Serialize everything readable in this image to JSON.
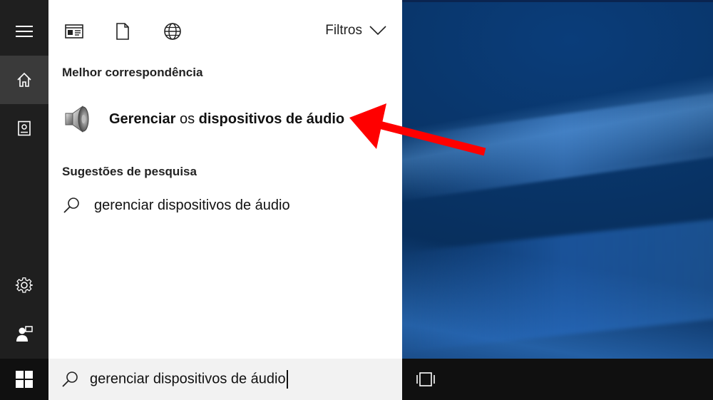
{
  "search_panel": {
    "filters_label": "Filtros",
    "best_match": {
      "section_title": "Melhor correspondência",
      "result": {
        "part1": "Gerenciar",
        "part2": " os ",
        "part3": "dispositivos de áudio"
      }
    },
    "suggestions": {
      "section_title": "Sugestões de pesquisa",
      "items": [
        {
          "text": "gerenciar dispositivos de áudio"
        }
      ]
    }
  },
  "taskbar": {
    "search_query": "gerenciar dispositivos de áudio"
  },
  "colors": {
    "rail_bg": "#1f1f1f",
    "rail_active": "#3a3a3a",
    "annotation_arrow": "#ff0000",
    "taskbar_bg": "#101010"
  }
}
